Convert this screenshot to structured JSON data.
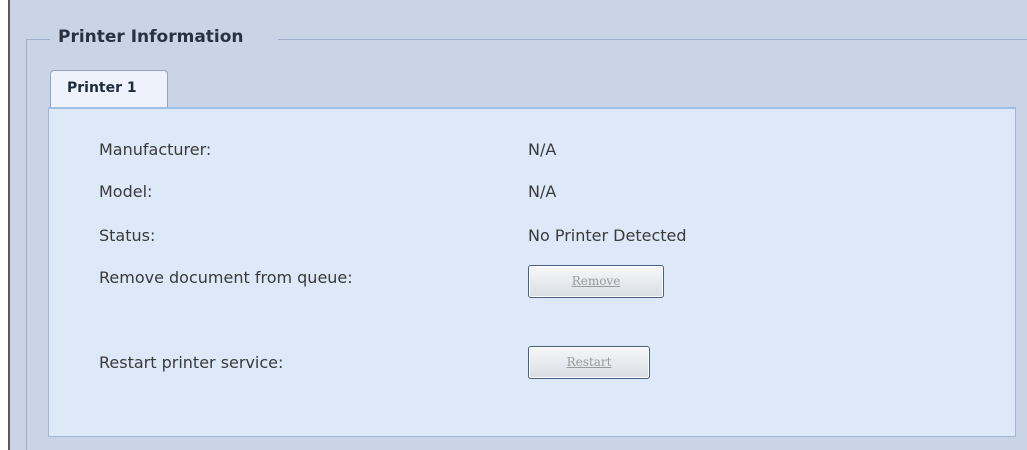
{
  "fieldset": {
    "legend": "Printer Information"
  },
  "tabs": [
    {
      "label": "Printer 1",
      "active": true
    }
  ],
  "printer": {
    "manufacturer": {
      "label": "Manufacturer:",
      "value": "N/A"
    },
    "model": {
      "label": "Model:",
      "value": "N/A"
    },
    "status": {
      "label": "Status:",
      "value": "No Printer Detected"
    },
    "remove_queue": {
      "label": "Remove document from queue:",
      "button": "Remove"
    },
    "restart_service": {
      "label": "Restart printer service:",
      "button": "Restart"
    }
  },
  "colors": {
    "panel_bg": "#c9d5e6",
    "content_bg": "#dde8f8",
    "tab_bg": "#eef3fb",
    "button_border": "#4a5f82"
  }
}
